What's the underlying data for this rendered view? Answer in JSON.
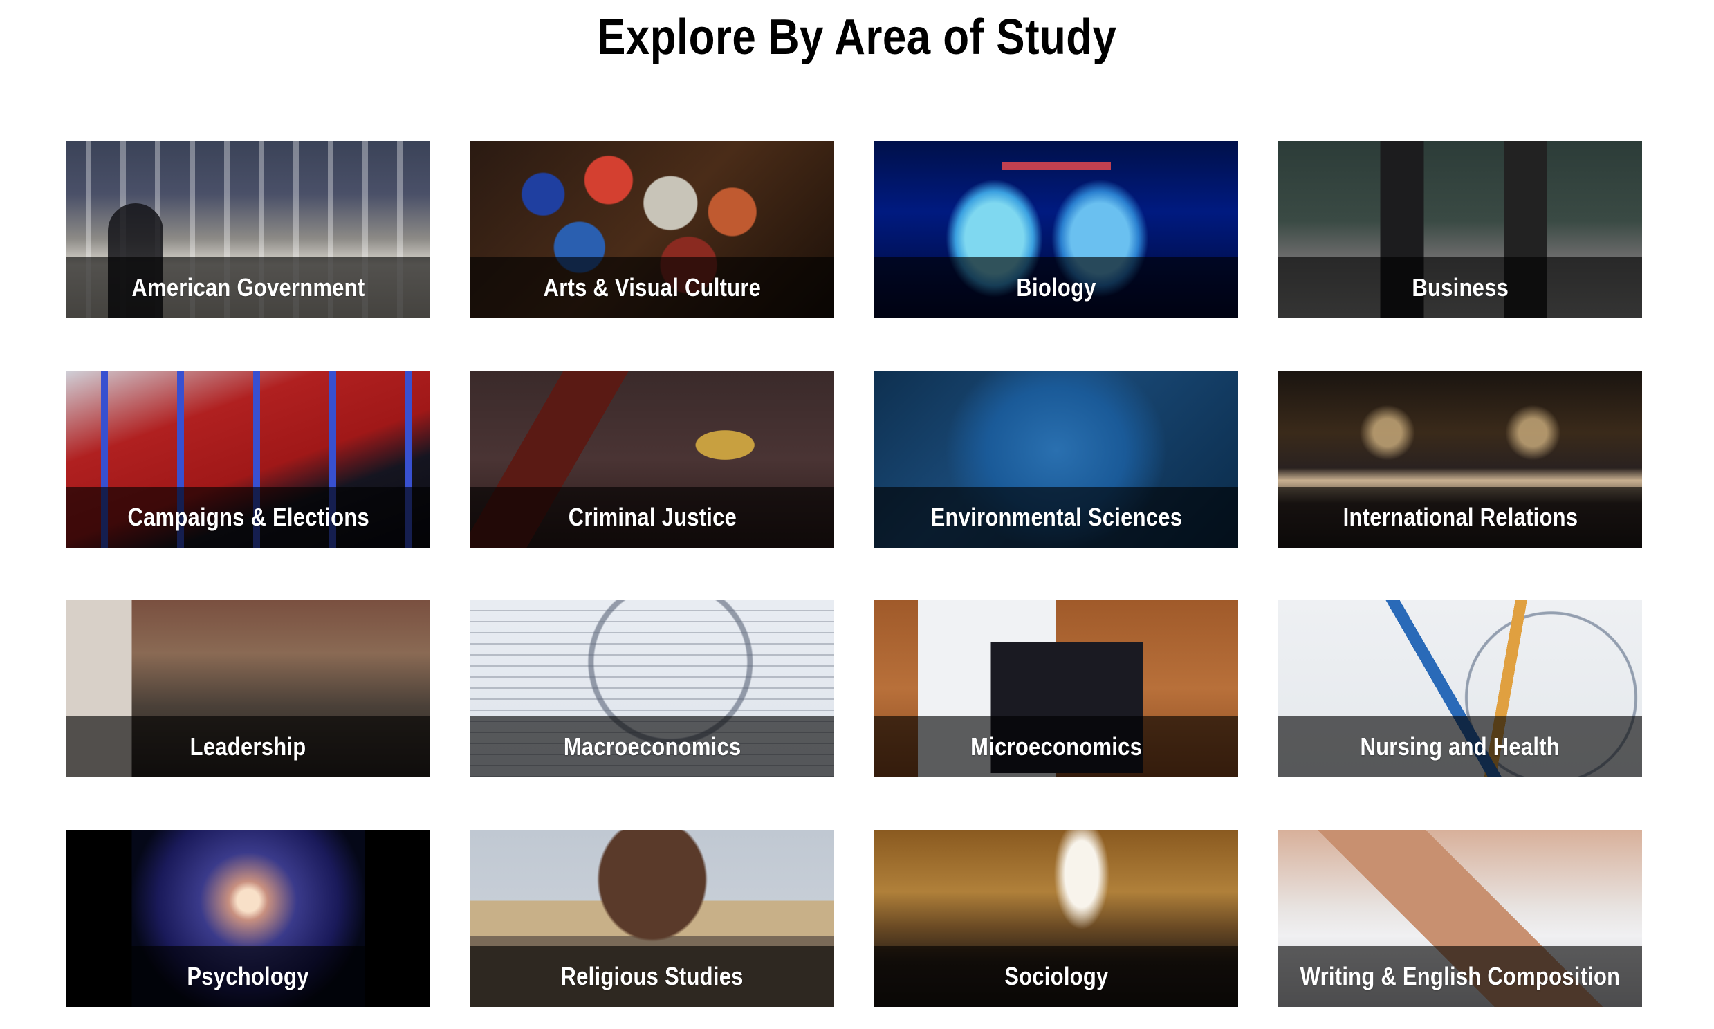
{
  "page": {
    "title": "Explore By Area of Study"
  },
  "areas": [
    {
      "label": "American Government",
      "image": "supreme-court-photo"
    },
    {
      "label": "Arts & Visual Culture",
      "image": "paint-pots-photo"
    },
    {
      "label": "Biology",
      "image": "petri-dishes-photo"
    },
    {
      "label": "Business",
      "image": "wall-street-photo"
    },
    {
      "label": "Campaigns & Elections",
      "image": "debate-stage-photo"
    },
    {
      "label": "Criminal Justice",
      "image": "gavel-scales-photo"
    },
    {
      "label": "Environmental Sciences",
      "image": "diver-fish-photo"
    },
    {
      "label": "International Relations",
      "image": "conference-hall-photo"
    },
    {
      "label": "Leadership",
      "image": "speaker-audience-photo"
    },
    {
      "label": "Macroeconomics",
      "image": "magnifier-chart-photo"
    },
    {
      "label": "Microeconomics",
      "image": "tablet-financial-photo"
    },
    {
      "label": "Nursing and Health",
      "image": "culture-plates-photo"
    },
    {
      "label": "Psychology",
      "image": "galaxy-head-photo"
    },
    {
      "label": "Religious Studies",
      "image": "church-domes-photo"
    },
    {
      "label": "Sociology",
      "image": "grand-central-photo"
    },
    {
      "label": "Writing & English Composition",
      "image": "hand-pen-photo"
    }
  ]
}
